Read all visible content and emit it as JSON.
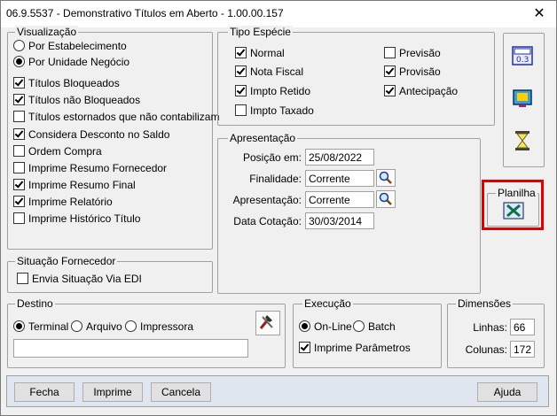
{
  "window": {
    "title": "06.9.5537 - Demonstrativo Títulos em Aberto - 1.00.00.157",
    "close_label": "✕"
  },
  "visualizacao": {
    "legend": "Visualização",
    "radios": [
      {
        "label": "Por Estabelecimento",
        "checked": false
      },
      {
        "label": "Por Unidade Negócio",
        "checked": true
      }
    ],
    "checks": [
      {
        "label": "Títulos Bloqueados",
        "checked": true
      },
      {
        "label": "Títulos não Bloqueados",
        "checked": true
      },
      {
        "label": "Títulos estornados que não contabilizam",
        "checked": false
      },
      {
        "label": "Considera Desconto no Saldo",
        "checked": true
      },
      {
        "label": "Ordem Compra",
        "checked": false
      },
      {
        "label": "Imprime Resumo Fornecedor",
        "checked": false
      },
      {
        "label": "Imprime Resumo Final",
        "checked": true
      },
      {
        "label": "Imprime Relatório",
        "checked": true
      },
      {
        "label": "Imprime Histórico Título",
        "checked": false
      }
    ]
  },
  "situacao": {
    "legend": "Situação Fornecedor",
    "check": {
      "label": "Envia Situação Via EDI",
      "checked": false
    }
  },
  "tipo_especie": {
    "legend": "Tipo Espécie",
    "left": [
      {
        "label": "Normal",
        "checked": true
      },
      {
        "label": "Nota Fiscal",
        "checked": true
      },
      {
        "label": "Impto Retido",
        "checked": true
      },
      {
        "label": "Impto Taxado",
        "checked": false
      }
    ],
    "right": [
      {
        "label": "Previsão",
        "checked": false
      },
      {
        "label": "Provisão",
        "checked": true
      },
      {
        "label": "Antecipação",
        "checked": true
      }
    ]
  },
  "apresentacao": {
    "legend": "Apresentação",
    "posicao_label": "Posição em:",
    "posicao_value": "25/08/2022",
    "finalidade_label": "Finalidade:",
    "finalidade_value": "Corrente",
    "apresentacao_label": "Apresentação:",
    "apresentacao_value": "Corrente",
    "cotacao_label": "Data Cotação:",
    "cotacao_value": "30/03/2014"
  },
  "planilha": {
    "legend": "Planilha"
  },
  "destino": {
    "legend": "Destino",
    "options": [
      {
        "label": "Terminal",
        "checked": true
      },
      {
        "label": "Arquivo",
        "checked": false
      },
      {
        "label": "Impressora",
        "checked": false
      }
    ],
    "path_value": ""
  },
  "execucao": {
    "legend": "Execução",
    "options": [
      {
        "label": "On-Line",
        "checked": true
      },
      {
        "label": "Batch",
        "checked": false
      }
    ],
    "check": {
      "label": "Imprime Parâmetros",
      "checked": true
    }
  },
  "dimensoes": {
    "legend": "Dimensões",
    "linhas_label": "Linhas:",
    "linhas_value": "66",
    "colunas_label": "Colunas:",
    "colunas_value": "172"
  },
  "buttons": {
    "fecha": "Fecha",
    "imprime": "Imprime",
    "cancela": "Cancela",
    "ajuda": "Ajuda"
  },
  "icons": {
    "calc": "calculator-icon",
    "tv": "monitor-icon",
    "hourglass": "hourglass-icon",
    "excel": "spreadsheet-icon",
    "tools": "tools-icon",
    "search": "search-icon"
  }
}
